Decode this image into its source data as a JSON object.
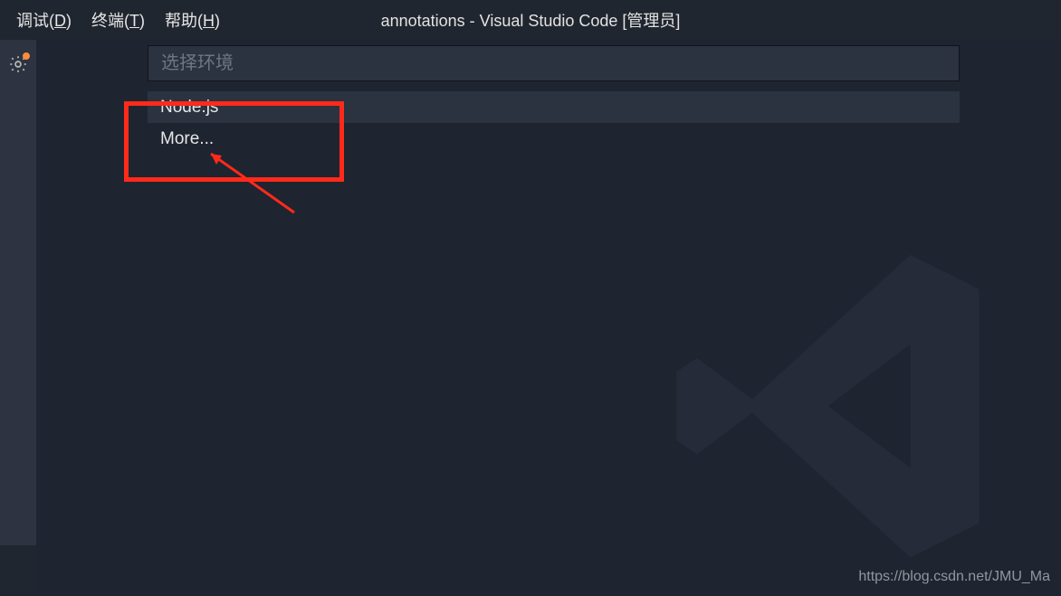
{
  "menubar": {
    "debug_prefix": "调试(",
    "debug_key": "D",
    "debug_suffix": ")",
    "terminal_prefix": "终端(",
    "terminal_key": "T",
    "terminal_suffix": ")",
    "help_prefix": "帮助(",
    "help_key": "H",
    "help_suffix": ")"
  },
  "window": {
    "title": "annotations - Visual Studio Code [管理员]"
  },
  "picker": {
    "placeholder": "选择环境",
    "options": [
      {
        "label": "Node.js",
        "highlight": true
      },
      {
        "label": "More...",
        "highlight": false
      }
    ]
  },
  "editor_toggle_glyph": "❯",
  "watermark_text": "https://blog.csdn.net/JMU_Ma"
}
